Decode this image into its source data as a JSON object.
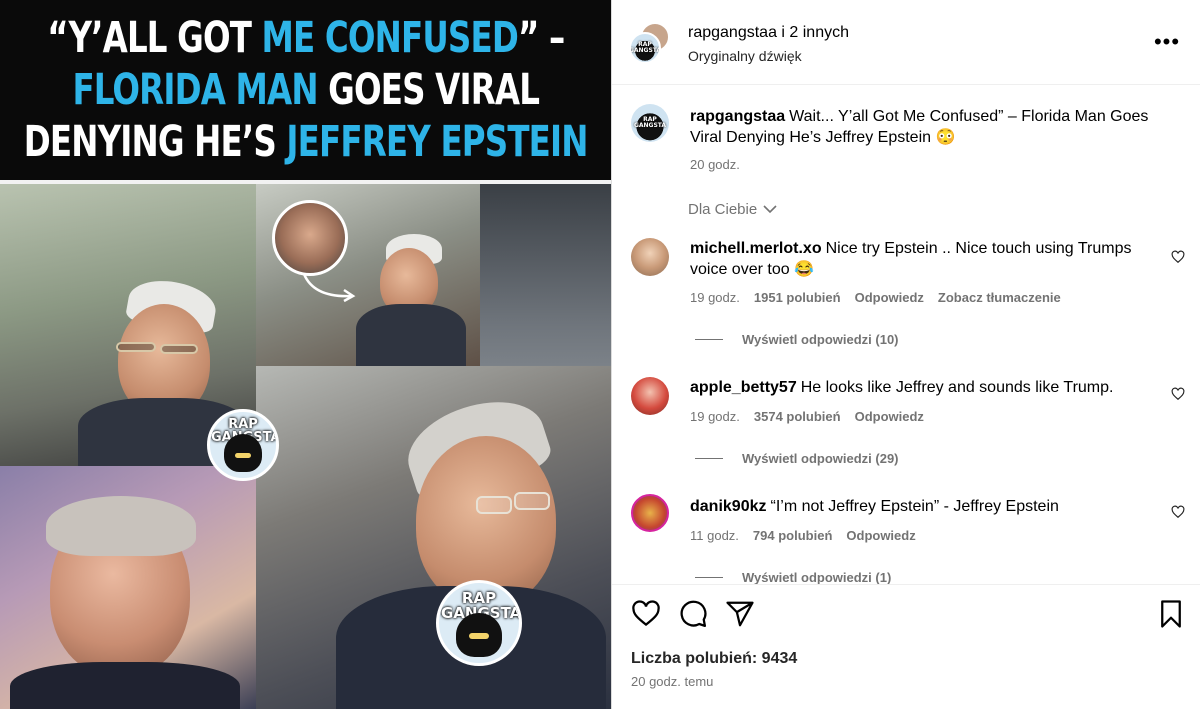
{
  "media": {
    "headline_lines": [
      [
        {
          "text": "“Y’ALL GOT ",
          "color": "white"
        },
        {
          "text": "ME CONFUSED",
          "color": "blue"
        },
        {
          "text": "” –",
          "color": "white"
        }
      ],
      [
        {
          "text": "FLORIDA MAN ",
          "color": "blue"
        },
        {
          "text": "GOES VIRAL",
          "color": "white"
        }
      ],
      [
        {
          "text": "DENYING HE’S ",
          "color": "white"
        },
        {
          "text": "JEFFREY EPSTEIN",
          "color": "blue"
        }
      ]
    ],
    "badge_text": "RAP GANGSTA",
    "colors": {
      "white": "#ffffff",
      "blue": "#2eb4e8"
    }
  },
  "header": {
    "title": "rapgangstaa i 2 innych",
    "subtitle": "Oryginalny dźwięk",
    "more_icon": "more-horizontal-icon",
    "more_label": "•••"
  },
  "caption": {
    "user": "rapgangstaa",
    "text": "Wait... Y’all Got Me Confused” – Florida Man Goes Viral Denying He’s Jeffrey Epstein 😳",
    "time": "20 godz."
  },
  "filter": {
    "label": "Dla Ciebie",
    "icon": "chevron-down-icon"
  },
  "comments": [
    {
      "user": "michell.merlot.xo",
      "text": "Nice try Epstein .. Nice touch using Trumps voice over too 😂",
      "time": "19 godz.",
      "likes": "1951 polubień",
      "reply": "Odpowiedz",
      "translate": "Zobacz tłumaczenie",
      "view_replies": "Wyświetl odpowiedzi (10)"
    },
    {
      "user": "apple_betty57",
      "text": "He looks like Jeffrey and sounds like Trump.",
      "time": "19 godz.",
      "likes": "3574 polubień",
      "reply": "Odpowiedz",
      "view_replies": "Wyświetl odpowiedzi (29)"
    },
    {
      "user": "danik90kz",
      "text": "“I’m not Jeffrey Epstein” - Jeffrey Epstein",
      "time": "11 godz.",
      "likes": "794 polubień",
      "reply": "Odpowiedz",
      "view_replies": "Wyświetl odpowiedzi (1)"
    }
  ],
  "actions": {
    "icons": [
      "heart-icon",
      "comment-icon",
      "share-icon",
      "bookmark-icon"
    ],
    "likes": "Liczba polubień: 9434",
    "time": "20 godz. temu"
  }
}
